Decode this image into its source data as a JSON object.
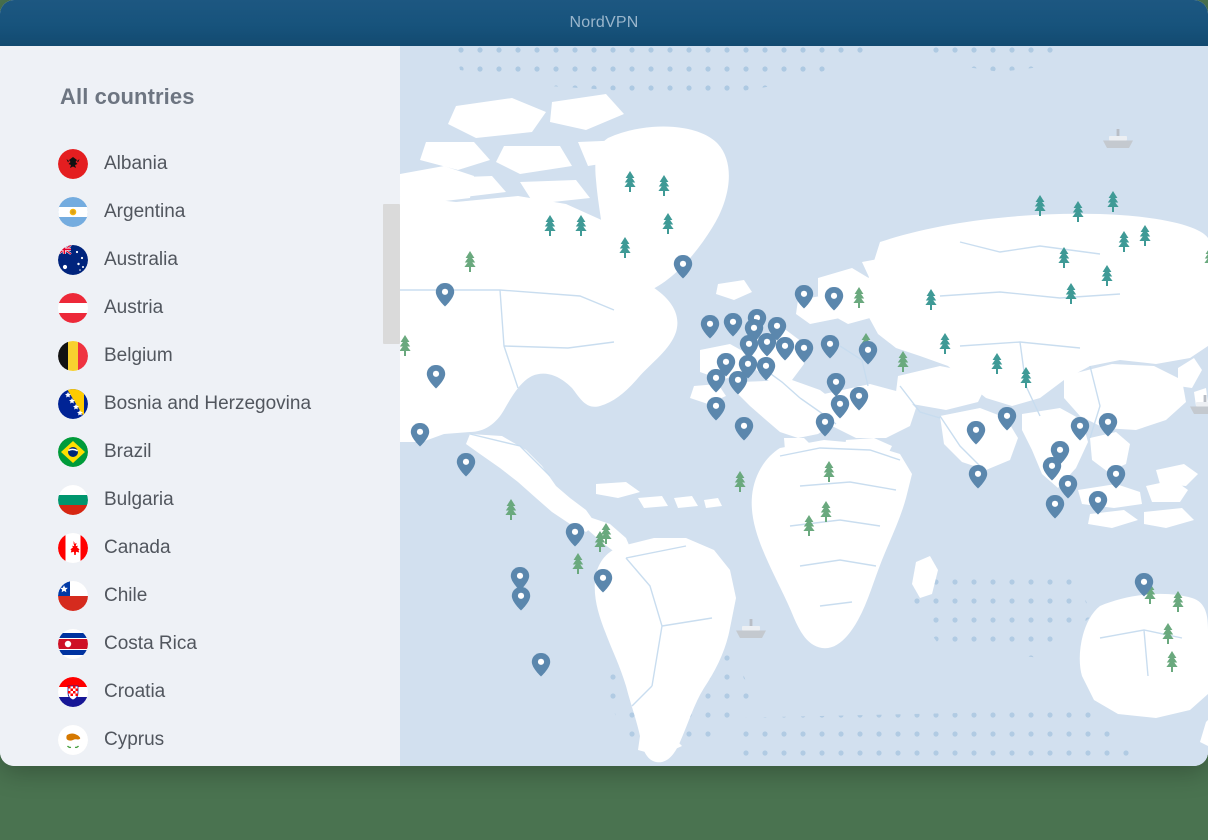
{
  "window": {
    "title": "NordVPN",
    "titlebar_color": "#17537c",
    "desktop_background": "#4a7350"
  },
  "sidebar": {
    "heading": "All countries",
    "background": "#eef1f6",
    "text_color": "#51565e",
    "heading_color": "#6d7581",
    "scrollbar": {
      "thumb_color": "#dadada",
      "track_color": "#eef1f6"
    },
    "countries": [
      {
        "name": "Albania",
        "flag_icon": "flag-albania",
        "code": "al"
      },
      {
        "name": "Argentina",
        "flag_icon": "flag-argentina",
        "code": "ar"
      },
      {
        "name": "Australia",
        "flag_icon": "flag-australia",
        "code": "au"
      },
      {
        "name": "Austria",
        "flag_icon": "flag-austria",
        "code": "at"
      },
      {
        "name": "Belgium",
        "flag_icon": "flag-belgium",
        "code": "be"
      },
      {
        "name": "Bosnia and Herzegovina",
        "flag_icon": "flag-bosnia",
        "code": "ba"
      },
      {
        "name": "Brazil",
        "flag_icon": "flag-brazil",
        "code": "br"
      },
      {
        "name": "Bulgaria",
        "flag_icon": "flag-bulgaria",
        "code": "bg"
      },
      {
        "name": "Canada",
        "flag_icon": "flag-canada",
        "code": "ca"
      },
      {
        "name": "Chile",
        "flag_icon": "flag-chile",
        "code": "cl"
      },
      {
        "name": "Costa Rica",
        "flag_icon": "flag-costa-rica",
        "code": "cr"
      },
      {
        "name": "Croatia",
        "flag_icon": "flag-croatia",
        "code": "hr"
      },
      {
        "name": "Cyprus",
        "flag_icon": "flag-cyprus",
        "code": "cy"
      }
    ]
  },
  "map": {
    "ocean_color": "#d2e0ef",
    "land_color": "#ffffff",
    "border_color": "#cfe0f0",
    "pin_color": "#5b87ad",
    "tree_color": "#3f9a96",
    "tree_color_alt": "#6aa97e",
    "ship_color": "#c4c9cf",
    "ice_dot_color": "#a9c6e0"
  }
}
